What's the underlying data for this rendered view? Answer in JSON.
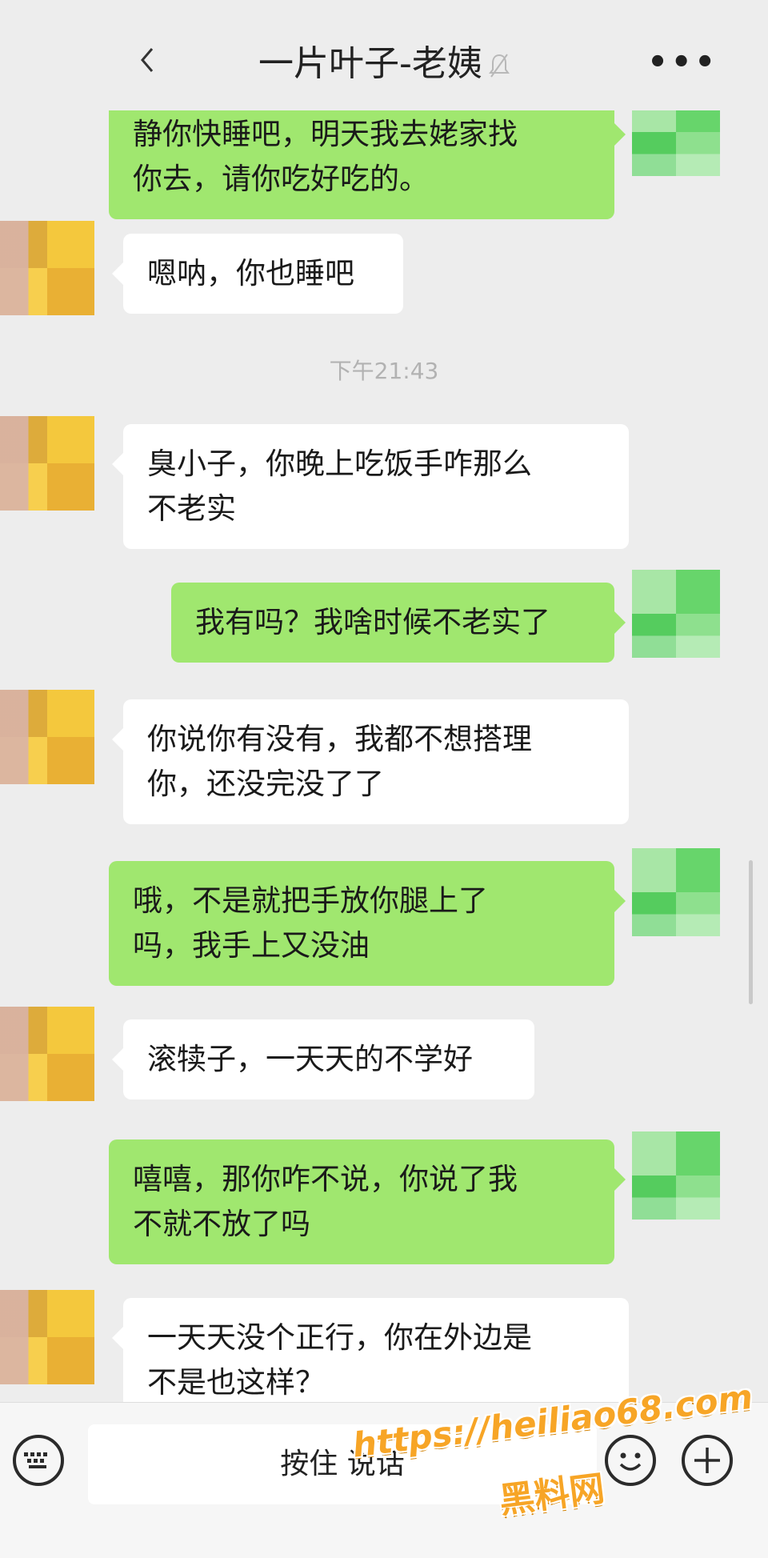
{
  "header": {
    "title": "一片叶子-老姨",
    "back_icon": "chevron-left-icon",
    "mute_icon": "bell-muted-icon",
    "more_label": "•••"
  },
  "messages": [
    {
      "side": "out",
      "lines": [
        "静你快睡吧，明天我去姥家找",
        "你去，请你吃好吃的。"
      ]
    },
    {
      "side": "in",
      "text": "嗯呐，你也睡吧"
    },
    {
      "side": "in",
      "lines": [
        "臭小子，你晚上吃饭手咋那么",
        "不老实"
      ]
    },
    {
      "side": "out",
      "text": "我有吗？我啥时候不老实了"
    },
    {
      "side": "in",
      "lines": [
        "你说你有没有，我都不想搭理",
        "你，还没完没了了"
      ]
    },
    {
      "side": "out",
      "lines": [
        "哦，不是就把手放你腿上了",
        "吗，我手上又没油"
      ]
    },
    {
      "side": "in",
      "text": "滚犊子，一天天的不学好"
    },
    {
      "side": "out",
      "lines": [
        "嘻嘻，那你咋不说，你说了我",
        "不就不放了吗"
      ]
    },
    {
      "side": "in",
      "lines": [
        "一天天没个正行，你在外边是",
        "不是也这样？"
      ]
    }
  ],
  "timestamp": "下午21:43",
  "input_bar": {
    "hold_to_talk": "按住 说话",
    "keyboard_icon": "keyboard-icon",
    "emoji_icon": "smiley-icon",
    "plus_icon": "plus-icon"
  },
  "watermark": {
    "url": "https://heiliao68.com",
    "name": "黑料网"
  },
  "colors": {
    "background": "#ededed",
    "outgoing_bubble": "#a0e76f",
    "incoming_bubble": "#ffffff",
    "watermark": "#f7a526"
  }
}
